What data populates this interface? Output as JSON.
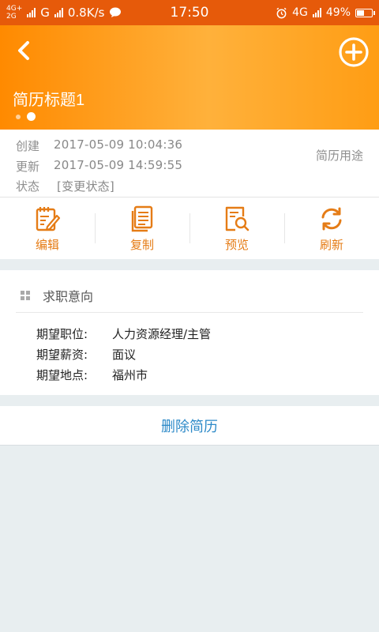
{
  "status_bar": {
    "net1": "4G+",
    "net2": "2G",
    "carrier": "G",
    "speed": "0.8K/s",
    "time": "17:50",
    "net3": "4G",
    "battery": "49%"
  },
  "header": {
    "title": "简历标题1",
    "back_icon": "chevron-left-icon",
    "add_icon": "plus-circle-icon",
    "page_index": 1,
    "page_count": 2
  },
  "info": {
    "created_label": "创建",
    "created_value": "2017-05-09 10:04:36",
    "updated_label": "更新",
    "updated_value": "2017-05-09 14:59:55",
    "status_label": "状态",
    "status_value": "[变更状态]",
    "purpose": "简历用途"
  },
  "actions": [
    {
      "label": "编辑",
      "icon": "edit-icon"
    },
    {
      "label": "复制",
      "icon": "copy-icon"
    },
    {
      "label": "预览",
      "icon": "preview-icon"
    },
    {
      "label": "刷新",
      "icon": "refresh-icon"
    }
  ],
  "job": {
    "title": "求职意向",
    "rows": [
      {
        "key": "期望职位:",
        "value": "人力资源经理/主管"
      },
      {
        "key": "期望薪资:",
        "value": "面议"
      },
      {
        "key": "期望地点:",
        "value": "福州市"
      }
    ]
  },
  "delete_label": "删除简历",
  "colors": {
    "accent_orange": "#e57c16",
    "link_blue": "#2d8ac8",
    "statusbar": "#e65a0a"
  }
}
